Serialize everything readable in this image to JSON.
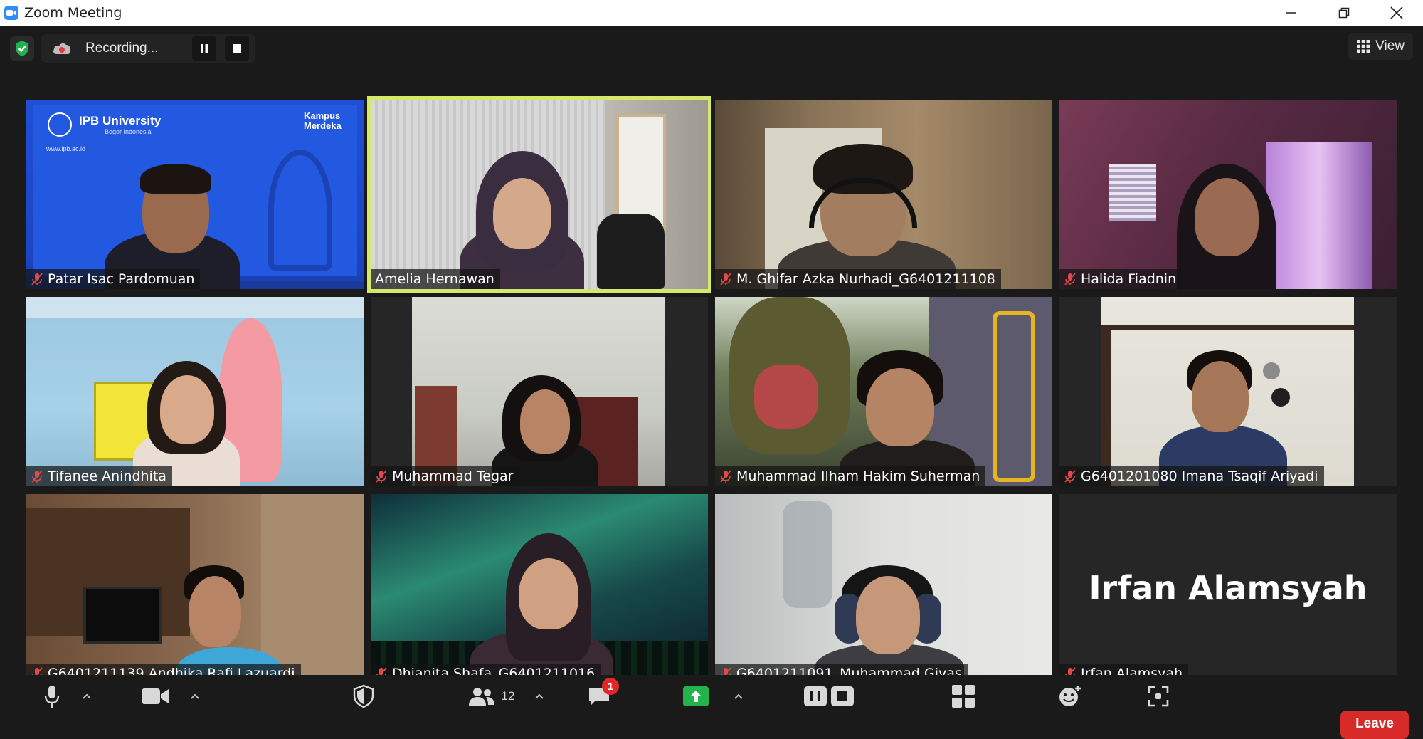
{
  "window": {
    "title": "Zoom Meeting"
  },
  "recording": {
    "label": "Recording..."
  },
  "view_button": {
    "label": "View"
  },
  "participants": [
    {
      "name": "Patar Isac Pardomuan",
      "muted": true
    },
    {
      "name": "Amelia Hernawan",
      "muted": false,
      "active_speaker": true
    },
    {
      "name": "M. Ghifar Azka Nurhadi_G6401211108",
      "muted": true
    },
    {
      "name": "Halida Fiadnin",
      "muted": true
    },
    {
      "name": "Tifanee Anindhita",
      "muted": true
    },
    {
      "name": "Muhammad Tegar",
      "muted": true
    },
    {
      "name": "Muhammad Ilham Hakim Suherman",
      "muted": true
    },
    {
      "name": "G6401201080 Imana Tsaqif Ariyadi",
      "muted": true
    },
    {
      "name": "G6401211139 Andhika Rafi Lazuardi",
      "muted": true
    },
    {
      "name": "Dhianita Shafa_G6401211016",
      "muted": true
    },
    {
      "name": "G6401211091_Muhammad Giyas",
      "muted": true
    },
    {
      "name": "Irfan Alamsyah",
      "muted": true,
      "video_off": true,
      "display_name": "Irfan Alamsyah"
    }
  ],
  "background_banner": {
    "org": "IPB University",
    "location": "Bogor Indonesia",
    "website": "www.ipb.ac.id",
    "brand": "Kampus Merdeka"
  },
  "toolbar": {
    "participants_count": "12",
    "chat_badge": "1",
    "leave_label": "Leave"
  },
  "colors": {
    "active_speaker_border": "#d6e86b",
    "leave": "#d92a2a",
    "share": "#24b24b",
    "mute_icon": "#e04a4a"
  }
}
